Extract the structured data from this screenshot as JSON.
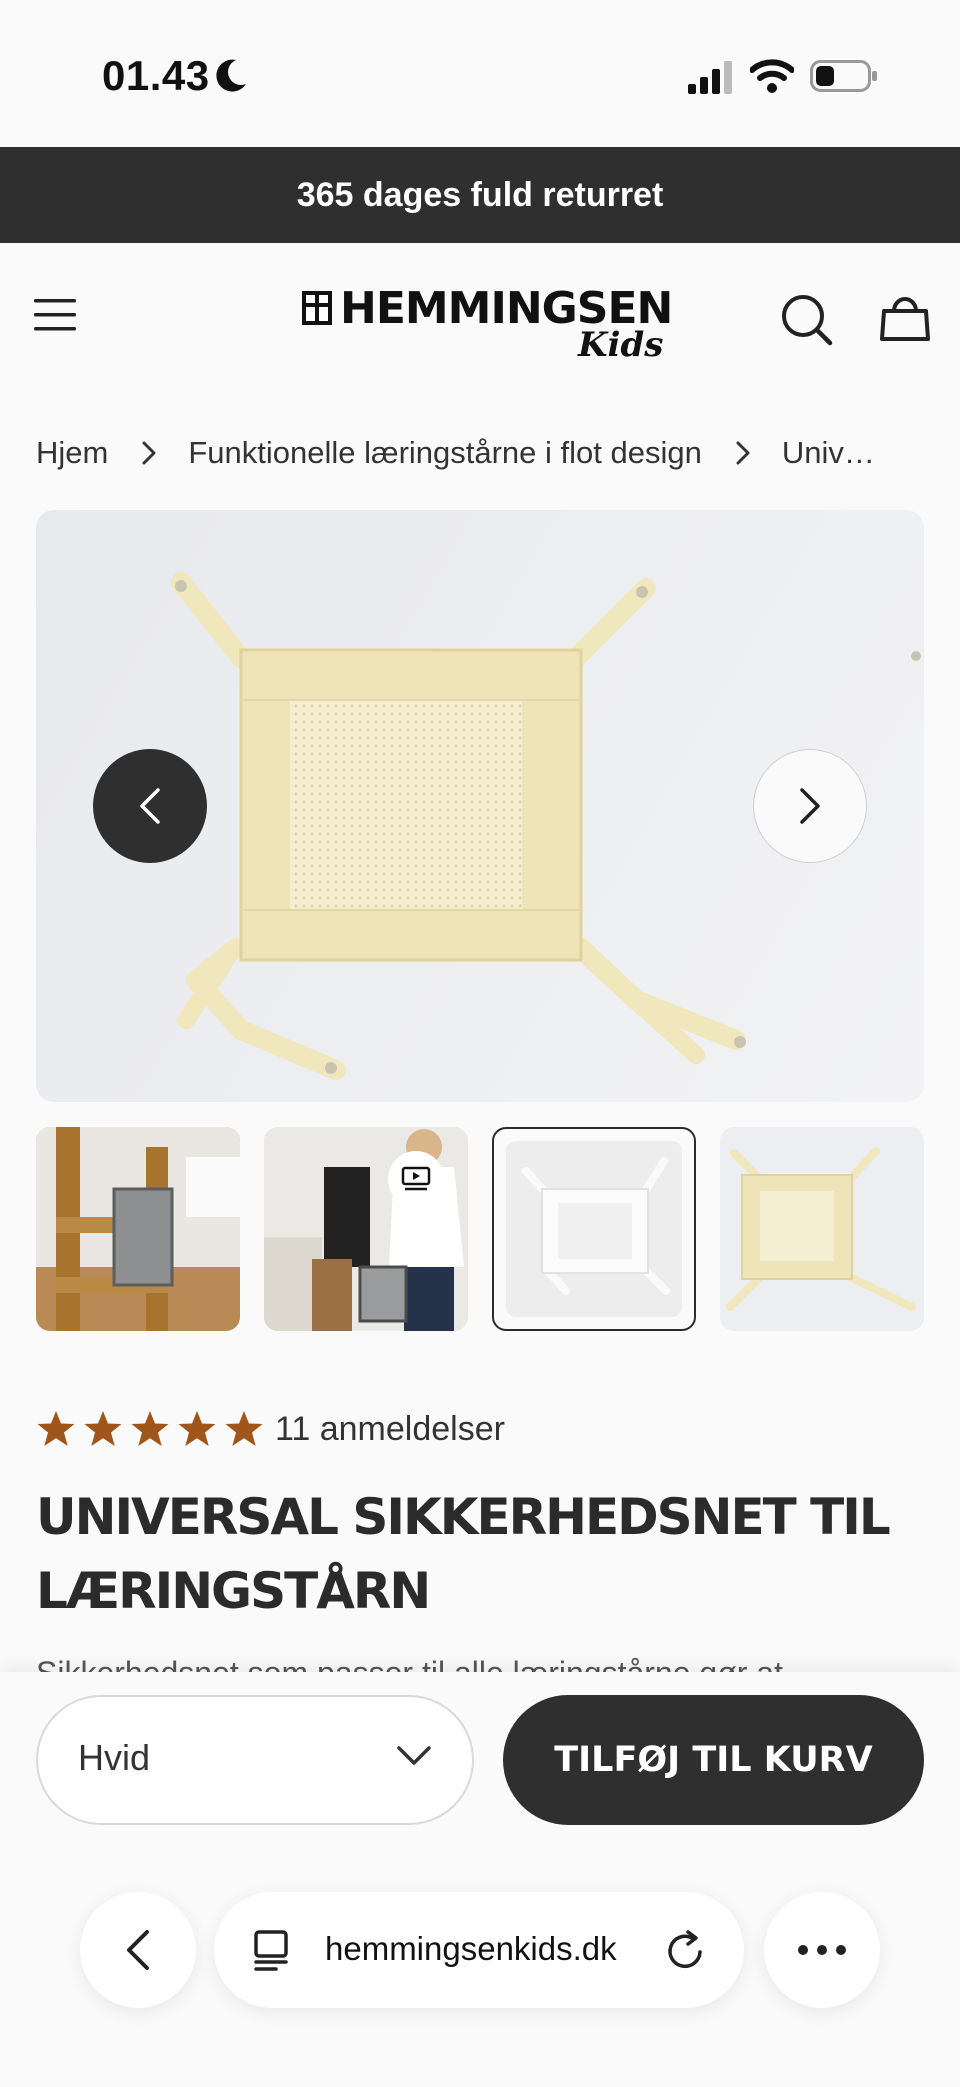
{
  "status_bar": {
    "time": "01.43"
  },
  "announcement": {
    "text": "365 dages fuld returret"
  },
  "header": {
    "logo_main": "HEMMINGSEN",
    "logo_sub": "Kids"
  },
  "breadcrumb": [
    {
      "label": "Hjem"
    },
    {
      "label": "Funktionelle læringstårne i flot design"
    },
    {
      "label": "Univ…"
    }
  ],
  "product": {
    "rating": 5,
    "review_count": "11 anmeldelser",
    "title": "UNIVERSAL SIKKERHEDSNET TIL LÆRINGSTÅRN",
    "description": "Sikkerhedsnet som passer til alle læringstårne gør at"
  },
  "purchase": {
    "variant_value": "Hvid",
    "add_to_cart_label": "TILFØJ TIL KURV"
  },
  "browser": {
    "url": "hemmingsenkids.dk"
  },
  "colors": {
    "dark": "#2f2f2f",
    "star": "#a0561b",
    "net": "#efe3b8"
  }
}
